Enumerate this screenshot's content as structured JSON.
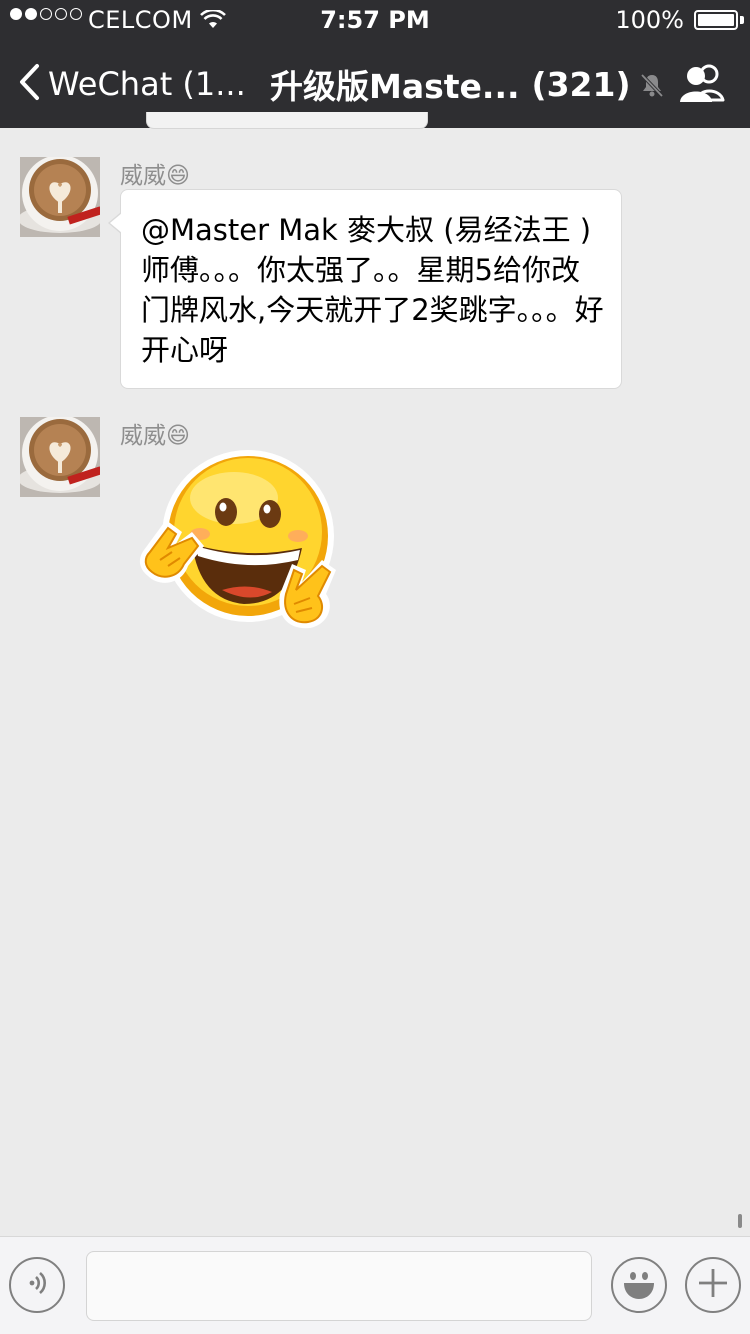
{
  "status_bar": {
    "carrier": "CELCOM",
    "time": "7:57 PM",
    "battery": "100%"
  },
  "nav": {
    "back_label": "WeChat (1...",
    "title": "升级版Maste...",
    "member_count": "(321)"
  },
  "messages": [
    {
      "sender": "威威😄",
      "text": "@Master Mak 麥大叔 (易经法王 ) 师傅。。。你太强了。。星期5给你改门牌风水,今天就开了2奖跳字。。。好开心呀"
    },
    {
      "sender": "威威😄",
      "sticker": "peace-sign-smiley-sticker"
    }
  ],
  "input_bar": {
    "placeholder": ""
  },
  "colors": {
    "nav_background": "#2e2e31",
    "chat_background": "#ebebeb",
    "bubble": "#ffffff",
    "sticker_yellow": "#f5b400"
  },
  "icons": [
    "chevron-left-icon",
    "mute-bell-icon",
    "group-members-icon",
    "voice-icon",
    "emoji-icon",
    "add-icon",
    "wifi-icon"
  ]
}
